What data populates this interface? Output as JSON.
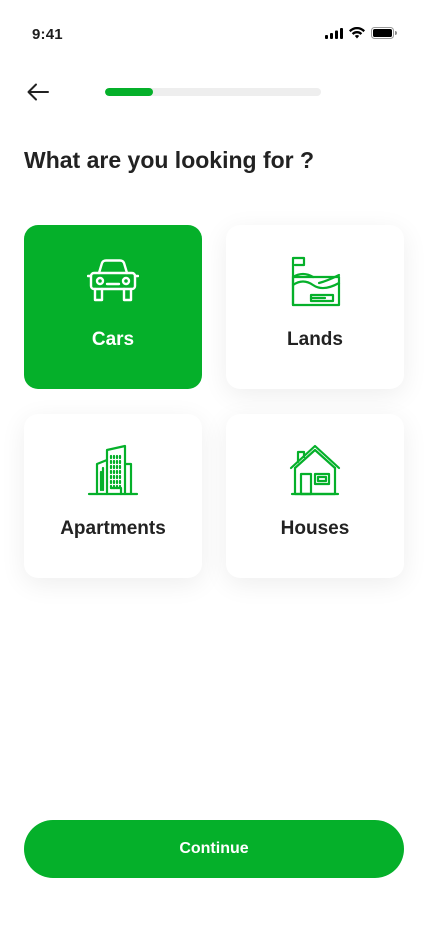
{
  "status_bar": {
    "time": "9:41",
    "icons": [
      "cellular-signal-icon",
      "wifi-icon",
      "battery-icon"
    ]
  },
  "header": {
    "back_icon": "arrow-left-icon",
    "progress": 0.22
  },
  "title": "What are you looking for ?",
  "options": [
    {
      "label": "Cars",
      "icon": "car-icon",
      "selected": true
    },
    {
      "label": "Lands",
      "icon": "land-icon",
      "selected": false
    },
    {
      "label": "Apartments",
      "icon": "apartment-building-icon",
      "selected": false
    },
    {
      "label": "Houses",
      "icon": "house-icon",
      "selected": false
    }
  ],
  "continue_label": "Continue",
  "colors": {
    "accent": "#05b02a",
    "track": "#eeeeee",
    "text": "#222222"
  }
}
